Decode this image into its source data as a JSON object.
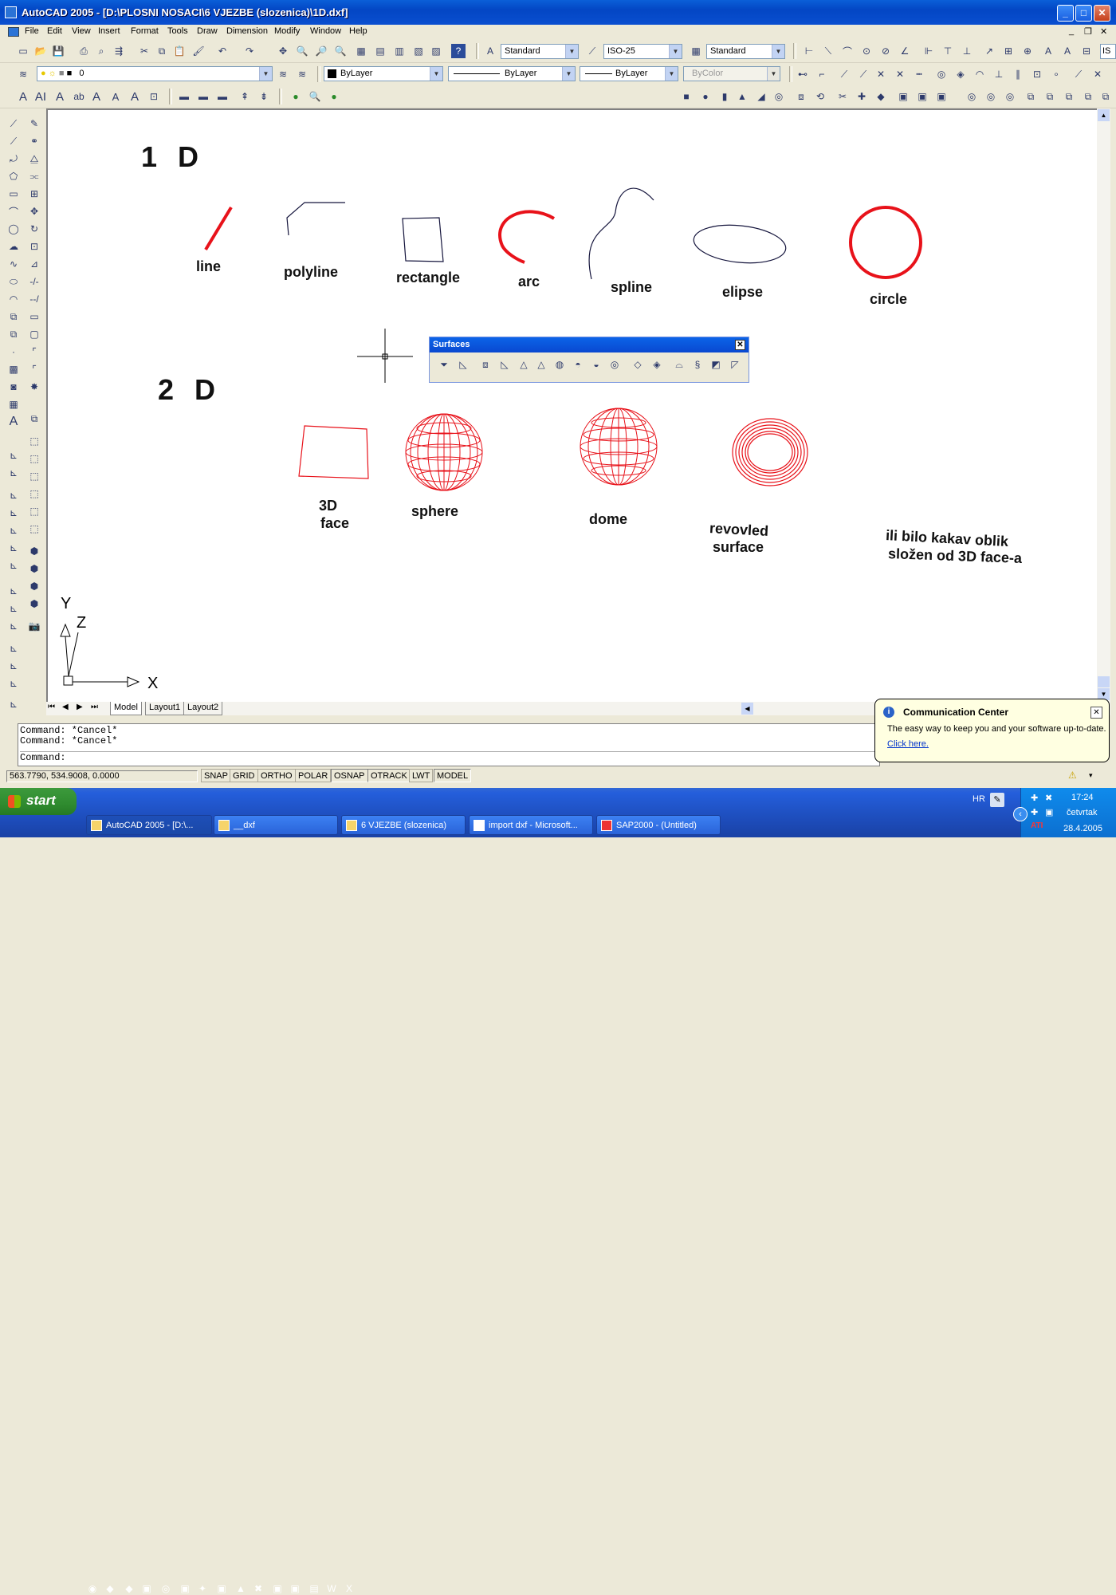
{
  "window": {
    "title": "AutoCAD 2005 - [D:\\PLOSNI  NOSACI\\6 VJEZBE (slozenica)\\1D.dxf]",
    "minimize_label": "_",
    "maximize_label": "□",
    "close_label": "✕",
    "doc_min_label": "_",
    "doc_restore_label": "❐",
    "doc_close_label": "✕"
  },
  "menu": {
    "items": [
      "File",
      "Edit",
      "View",
      "Insert",
      "Format",
      "Tools",
      "Draw",
      "Dimension",
      "Modify",
      "Window",
      "Help"
    ]
  },
  "toolbars": {
    "text_style": "Standard",
    "dim_style": "ISO-25",
    "table_style": "Standard",
    "extra_style_cut": "IS",
    "layer": "0",
    "color": "ByLayer",
    "linetype": "ByLayer",
    "lineweight": "ByLayer",
    "plotstyle": "ByColor"
  },
  "drawing": {
    "heading_1d": "1 D",
    "heading_2d": "2 D",
    "labels": {
      "line": "line",
      "polyline": "polyline",
      "rectangle": "rectangle",
      "arc": "arc",
      "spline": "spline",
      "elipse": "elipse",
      "circle": "circle",
      "face_line1": "3D",
      "face_line2": "face",
      "sphere": "sphere",
      "dome": "dome",
      "revolved_line1": "revovled",
      "revolved_line2": "surface",
      "note_line1": "ili bilo kakav oblik",
      "note_line2": "složen od 3D face-a"
    },
    "ucs": {
      "x": "X",
      "y": "Y",
      "z": "Z"
    },
    "accent_red": "#e8121a",
    "line_dark": "#14143c"
  },
  "surfaces_toolbar": {
    "title": "Surfaces",
    "close_label": "✕"
  },
  "layout_tabs": [
    "Model",
    "Layout1",
    "Layout2"
  ],
  "command": {
    "line1": "Command:  *Cancel*",
    "line2": "Command:  *Cancel*",
    "prompt": "Command:"
  },
  "status": {
    "coords": "563.7790,  534.9008, 0.0000",
    "buttons": [
      "SNAP",
      "GRID",
      "ORTHO",
      "POLAR",
      "OSNAP",
      "OTRACK",
      "LWT",
      "MODEL"
    ]
  },
  "comm_center": {
    "title": "Communication Center",
    "message": "The easy way to keep you and your software up-to-date.",
    "link": "Click here.",
    "close_label": "✕"
  },
  "taskbar": {
    "start_label": "start",
    "tasks": [
      "AutoCAD 2005 - [D:\\...",
      "__dxf",
      "6 VJEZBE (slozenica)",
      "import dxf - Microsoft...",
      "SAP2000 - (Untitled)"
    ],
    "language": "HR",
    "time": "17:24",
    "day": "četvrtak",
    "date": "28.4.2005"
  }
}
